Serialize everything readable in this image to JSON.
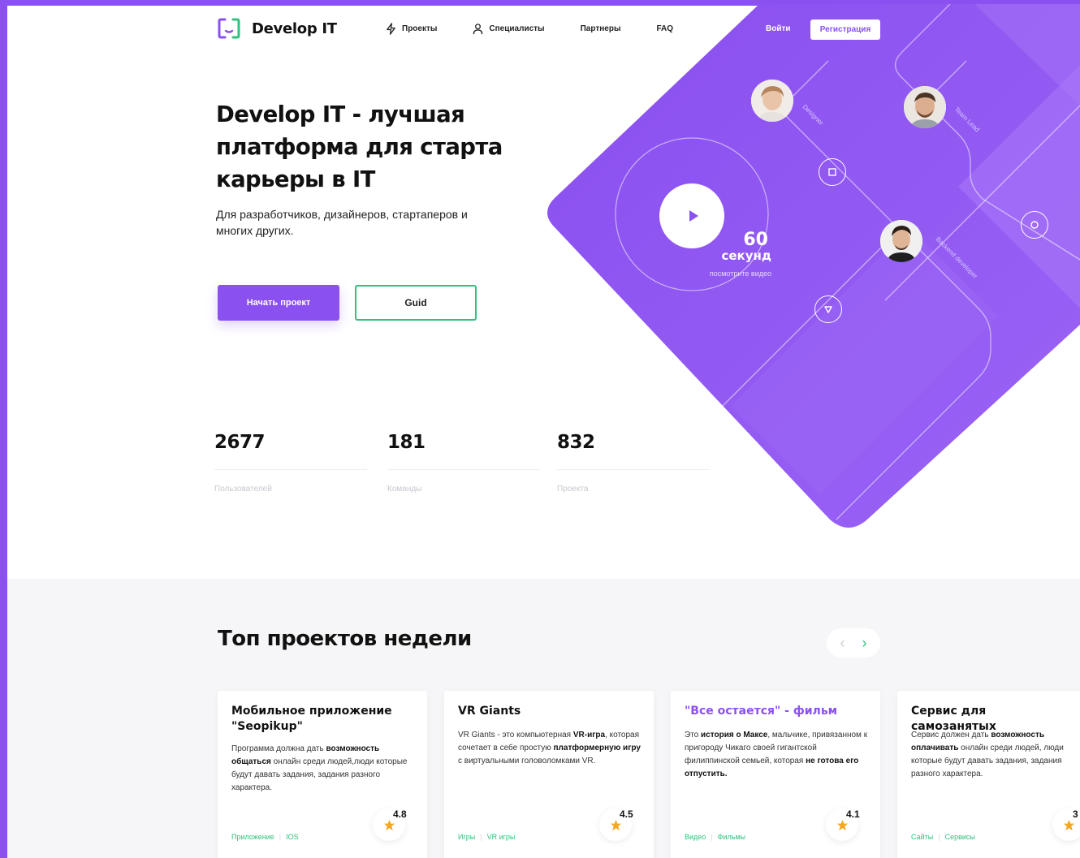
{
  "brand": {
    "name": "Develop IT"
  },
  "nav": [
    {
      "label": "Проекты",
      "icon": "lightning-icon"
    },
    {
      "label": "Специалисты",
      "icon": "user-icon"
    },
    {
      "label": "Партнеры"
    },
    {
      "label": "FAQ"
    }
  ],
  "auth": {
    "login": "Войти",
    "register": "Регистрация"
  },
  "hero": {
    "title": "Develop IT - лучшая платформа для старта карьеры в IT",
    "subtitle": "Для разработчиков, дизайнеров, стартаперов и многих других.",
    "primary_button": "Начать проект",
    "secondary_button": "Guid"
  },
  "stats": [
    {
      "value": "2677",
      "label": "Пользователей"
    },
    {
      "value": "181",
      "label": "Команды"
    },
    {
      "value": "832",
      "label": "Проекта"
    }
  ],
  "video": {
    "number": "60",
    "unit": "секунд",
    "hint": "посмотрите видео"
  },
  "roles": {
    "designer": "Designer",
    "team_lead": "Team Lead",
    "backend": "Backend developer"
  },
  "projects": {
    "title": "Топ проектов недели",
    "prev": "‹",
    "next": "›",
    "cards": [
      {
        "title": "Мобильное приложение \"Seopikup\"",
        "desc": {
          "a": "Программа должна дать ",
          "b": "возможность общаться",
          "c": " онлайн среди людей,люди которые будут давать задания, задания разного характера."
        },
        "tags": [
          "Приложение",
          "IOS"
        ],
        "rating": "4.8"
      },
      {
        "title": "VR Giants",
        "desc": {
          "a": "VR Giants - это компьютерная ",
          "b": "VR-игра",
          "c": ", которая сочетает в себе простую ",
          "d": "платформерную игру",
          "e": " с виртуальными головоломками VR."
        },
        "tags": [
          "Игры",
          "VR игры"
        ],
        "rating": "4.5"
      },
      {
        "title": "\"Все остается\" - фильм",
        "desc": {
          "a": "Это ",
          "b": "история о Максе",
          "c": ", мальчике, привязанном к пригороду Чикаго своей гигантской филиппинской семьей, которая ",
          "d": "не готова его отпустить."
        },
        "tags": [
          "Видео",
          "Фильмы"
        ],
        "rating": "4.1"
      },
      {
        "title": "Сервис для самозанятых",
        "desc": {
          "a": "Сервис должен дать ",
          "b": "возможность оплачивать",
          "c": " онлайн среди людей, люди которые будут давать задания, задания разного характера."
        },
        "tags": [
          "Сайты",
          "Сервисы"
        ],
        "rating": "3"
      }
    ]
  },
  "colors": {
    "accent": "#8b50f0",
    "green": "#2ec27e",
    "star": "#f5a623"
  }
}
